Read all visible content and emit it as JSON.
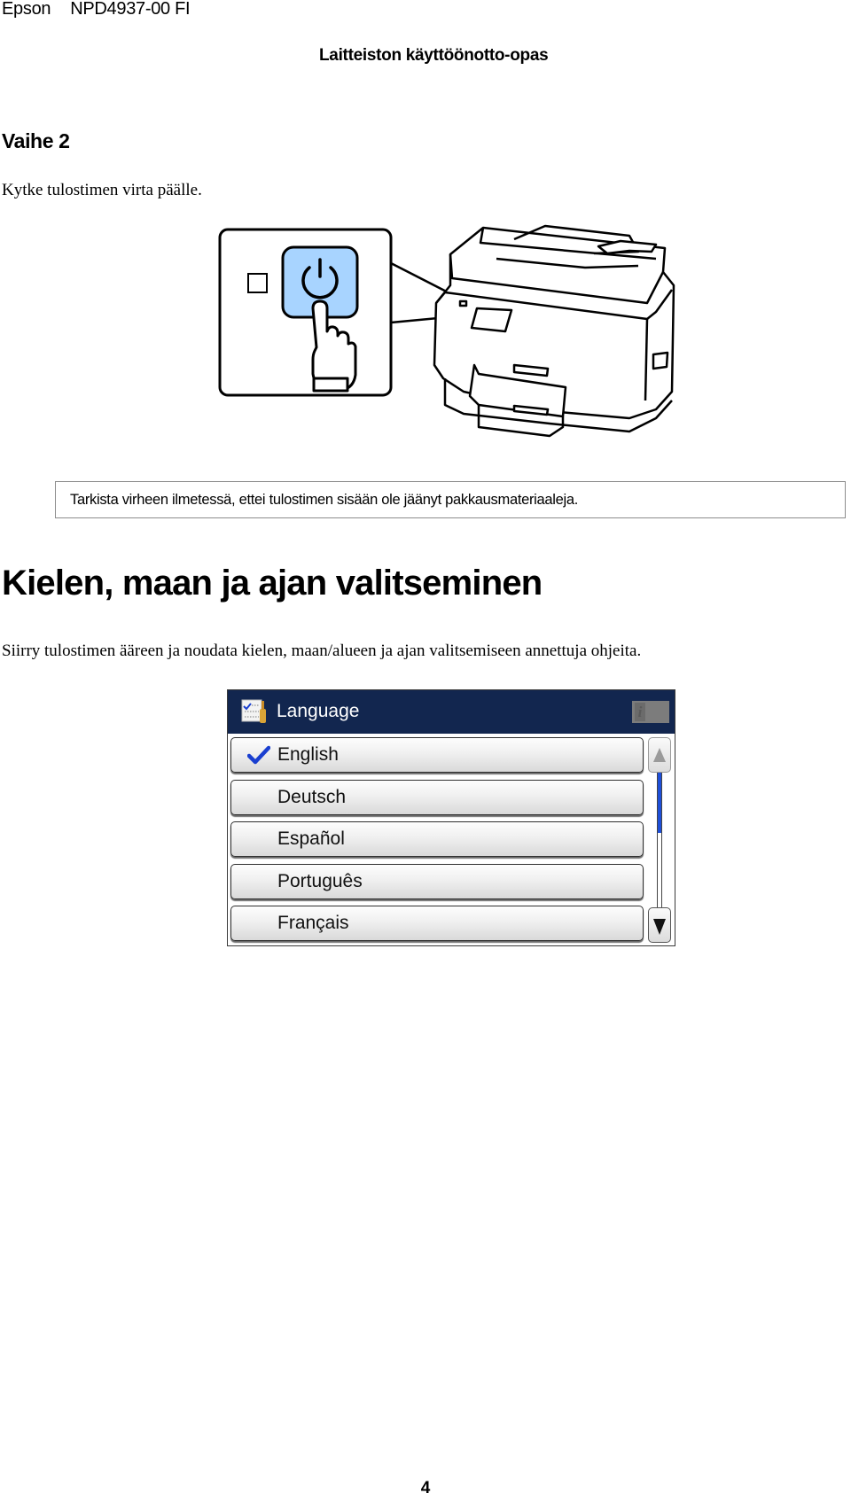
{
  "header": {
    "brand": "Epson",
    "doc_code": "NPD4937-00 FI",
    "guide_title": "Laitteiston käyttöönotto-opas"
  },
  "step": {
    "title": "Vaihe 2",
    "instruction": "Kytke tulostimen virta päälle."
  },
  "illustration": {
    "power_button_color": "#a8d4ff",
    "icons": [
      "power-icon",
      "pointing-hand-icon",
      "printer-icon"
    ]
  },
  "note": {
    "text": "Tarkista virheen ilmetessä, ettei tulostimen sisään ole jäänyt pakkausmateriaaleja."
  },
  "section": {
    "title": "Kielen, maan ja ajan valitseminen",
    "text": "Siirry tulostimen ääreen ja noudata kielen, maan/alueen ja ajan valitsemiseen annettuja ohjeita."
  },
  "lcd": {
    "title": "Language",
    "header_color": "#12264f",
    "info_label": "i",
    "scroll_position": 0.45,
    "items": [
      {
        "label": "English",
        "selected": true
      },
      {
        "label": "Deutsch",
        "selected": false
      },
      {
        "label": "Español",
        "selected": false
      },
      {
        "label": "Português",
        "selected": false
      },
      {
        "label": "Français",
        "selected": false
      }
    ]
  },
  "footer": {
    "page_number": "4"
  }
}
